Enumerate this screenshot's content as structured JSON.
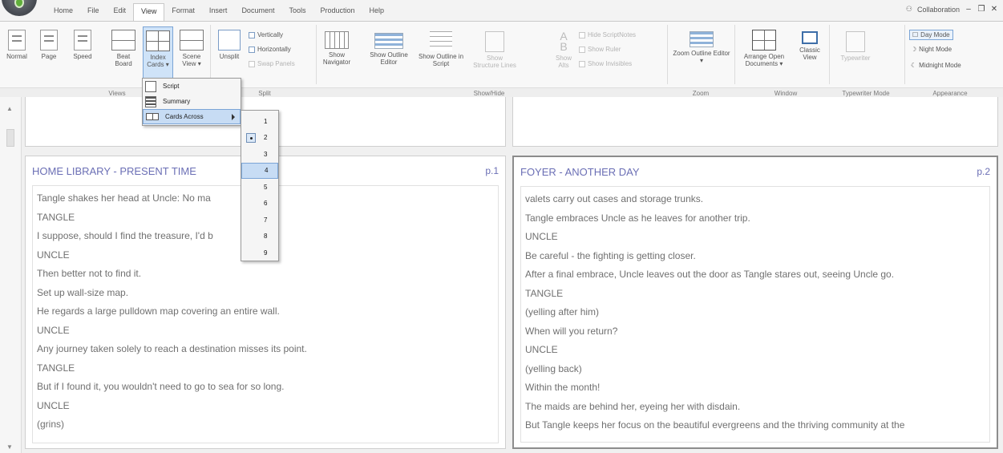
{
  "menu": {
    "tabs": [
      "Home",
      "File",
      "Edit",
      "View",
      "Format",
      "Insert",
      "Document",
      "Tools",
      "Production",
      "Help"
    ],
    "active_tab": "View",
    "collaboration": "Collaboration",
    "win_min": "–",
    "win_restore": "❐",
    "win_close": "✕"
  },
  "ribbon": {
    "views": {
      "normal": "Normal",
      "page": "Page",
      "speed": "Speed",
      "beat_board": "Beat Board",
      "index_cards": "Index Cards ▾",
      "scene_view": "Scene View ▾"
    },
    "split": {
      "unsplit": "Unsplit",
      "vertically": "Vertically",
      "horizontally": "Horizontally",
      "swap_panels": "Swap Panels"
    },
    "show_hide": {
      "show_navigator": "Show Navigator",
      "show_outline_editor": "Show Outline Editor",
      "show_outline_in_script": "Show Outline in Script",
      "show_structure_lines": "Show Structure Lines",
      "show_alts": "Show Alts",
      "hide_scriptnotes": "Hide ScriptNotes",
      "show_ruler": "Show Ruler",
      "show_invisibles": "Show Invisibles"
    },
    "zoom": {
      "zoom_outline_editor": "Zoom Outline Editor ▾"
    },
    "window": {
      "arrange_open_documents": "Arrange Open Documents ▾",
      "classic_view": "Classic View"
    },
    "typewriter": {
      "typewriter": "Typewriter"
    },
    "appearance": {
      "day_mode": "Day Mode",
      "night_mode": "Night Mode",
      "midnight_mode": "Midnight Mode"
    },
    "group_labels": {
      "views": "Views",
      "split": "Split",
      "show_hide": "Show/Hide",
      "zoom": "Zoom",
      "window": "Window",
      "typewriter_mode": "Typewriter Mode",
      "appearance": "Appearance"
    }
  },
  "dropdown": {
    "items": [
      "Script",
      "Summary",
      "Cards Across"
    ]
  },
  "submenu": {
    "items": [
      "1",
      "2",
      "3",
      "4",
      "5",
      "6",
      "7",
      "8",
      "9"
    ],
    "checked": "2",
    "highlighted": "4"
  },
  "cards": [
    {
      "title": "HOME LIBRARY - PRESENT TIME",
      "page": "p.1",
      "lines": [
        "Tangle shakes her head at Uncle: No ma",
        "TANGLE",
        "I suppose, should I find the treasure, I'd b",
        "UNCLE",
        "Then better not to find it.",
        "Set up wall-size map.",
        "He regards a large pulldown map covering an entire wall.",
        "UNCLE",
        "Any journey taken solely to reach a destination misses its point.",
        "TANGLE",
        "But if I found it, you wouldn't need to go to sea for so long.",
        "UNCLE",
        "(grins)"
      ]
    },
    {
      "title": "FOYER - ANOTHER DAY",
      "page": "p.2",
      "lines": [
        "valets carry out cases and storage trunks.",
        "Tangle embraces Uncle as he leaves for another trip.",
        "UNCLE",
        "Be careful - the fighting is getting closer.",
        "After a final embrace, Uncle leaves out the door as Tangle stares out, seeing Uncle go.",
        "TANGLE",
        "(yelling after him)",
        "When will you return?",
        "UNCLE",
        "(yelling back)",
        "Within the month!",
        "The maids are behind her, eyeing her with disdain.",
        "But Tangle keeps her focus on the beautiful evergreens and the thriving community at the"
      ]
    }
  ]
}
